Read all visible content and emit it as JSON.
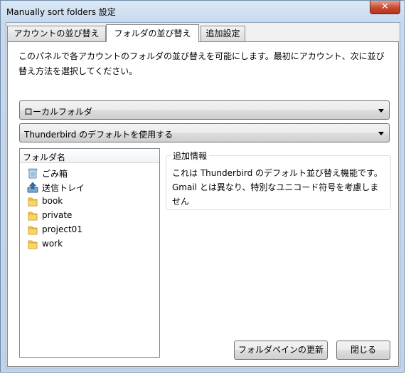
{
  "window": {
    "title": "Manually sort folders 設定",
    "close_glyph": "✕"
  },
  "tabs": [
    {
      "label": "アカウントの並び替え",
      "active": false
    },
    {
      "label": "フォルダの並び替え",
      "active": true
    },
    {
      "label": "追加設定",
      "active": false
    }
  ],
  "panel": {
    "description": "このパネルで各アカウントのフォルダの並び替えを可能にします。最初にアカウント、次に並び替え方法を選択してください。",
    "account_select": {
      "value": "ローカルフォルダ"
    },
    "sort_select": {
      "value": "Thunderbird のデフォルトを使用する"
    },
    "folder_list": {
      "header": "フォルダ名",
      "items": [
        {
          "label": "ごみ箱",
          "icon": "trash-icon"
        },
        {
          "label": "送信トレイ",
          "icon": "outbox-icon"
        },
        {
          "label": "book",
          "icon": "folder-icon"
        },
        {
          "label": "private",
          "icon": "folder-icon"
        },
        {
          "label": "project01",
          "icon": "folder-icon"
        },
        {
          "label": "work",
          "icon": "folder-icon"
        }
      ]
    },
    "info": {
      "legend": "追加情報",
      "text": "これは Thunderbird のデフォルト並び替え機能です。Gmail とは異なり、特別なユニコード符号を考慮しません"
    },
    "buttons": {
      "refresh": "フォルダペインの更新",
      "close": "閉じる"
    }
  },
  "colors": {
    "window_frame": "#c1d3ea",
    "close_button": "#c74a30",
    "folder_yellow": "#f4c542"
  }
}
